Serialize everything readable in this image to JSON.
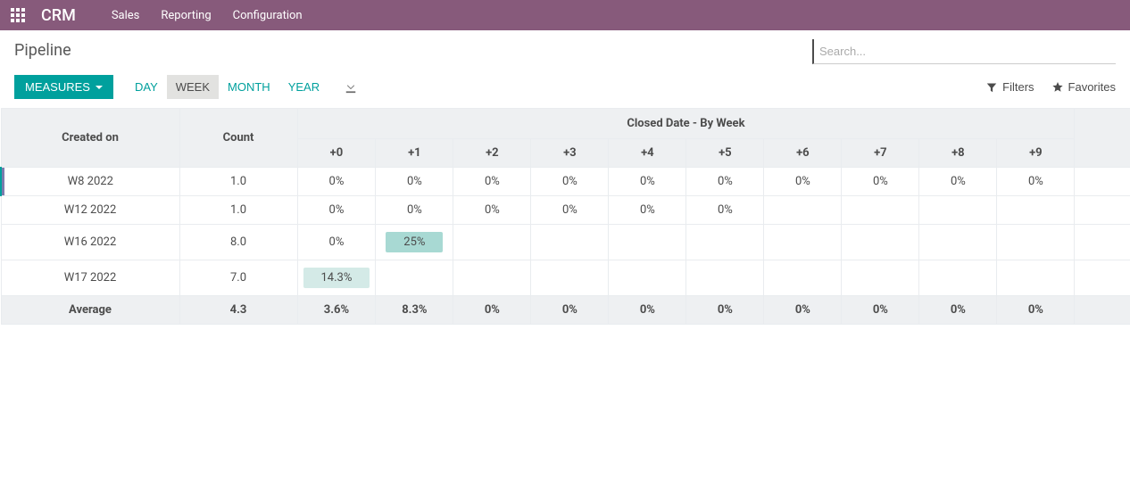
{
  "navbar": {
    "brand": "CRM",
    "links": [
      "Sales",
      "Reporting",
      "Configuration"
    ]
  },
  "page": {
    "title": "Pipeline"
  },
  "search": {
    "placeholder": "Search..."
  },
  "toolbar": {
    "measures_label": "MEASURES",
    "ranges": [
      {
        "label": "DAY",
        "active": false
      },
      {
        "label": "WEEK",
        "active": true
      },
      {
        "label": "MONTH",
        "active": false
      },
      {
        "label": "YEAR",
        "active": false
      }
    ],
    "filters_label": "Filters",
    "favorites_label": "Favorites"
  },
  "table": {
    "col_created_on": "Created on",
    "col_count": "Count",
    "super_header": "Closed Date - By Week",
    "period_headers": [
      "+0",
      "+1",
      "+2",
      "+3",
      "+4",
      "+5",
      "+6",
      "+7",
      "+8",
      "+9"
    ],
    "rows": [
      {
        "label": "W8 2022",
        "count": "1.0",
        "highlight": true,
        "cells": [
          {
            "v": "0%"
          },
          {
            "v": "0%"
          },
          {
            "v": "0%"
          },
          {
            "v": "0%"
          },
          {
            "v": "0%"
          },
          {
            "v": "0%"
          },
          {
            "v": "0%"
          },
          {
            "v": "0%"
          },
          {
            "v": "0%"
          },
          {
            "v": "0%"
          }
        ]
      },
      {
        "label": "W12 2022",
        "count": "1.0",
        "highlight": false,
        "cells": [
          {
            "v": "0%"
          },
          {
            "v": "0%"
          },
          {
            "v": "0%"
          },
          {
            "v": "0%"
          },
          {
            "v": "0%"
          },
          {
            "v": "0%"
          },
          {
            "v": ""
          },
          {
            "v": ""
          },
          {
            "v": ""
          },
          {
            "v": ""
          }
        ]
      },
      {
        "label": "W16 2022",
        "count": "8.0",
        "highlight": false,
        "cells": [
          {
            "v": "0%"
          },
          {
            "v": "25%",
            "shade": 2
          },
          {
            "v": ""
          },
          {
            "v": ""
          },
          {
            "v": ""
          },
          {
            "v": ""
          },
          {
            "v": ""
          },
          {
            "v": ""
          },
          {
            "v": ""
          },
          {
            "v": ""
          }
        ]
      },
      {
        "label": "W17 2022",
        "count": "7.0",
        "highlight": false,
        "cells": [
          {
            "v": "14.3%",
            "shade": 1
          },
          {
            "v": ""
          },
          {
            "v": ""
          },
          {
            "v": ""
          },
          {
            "v": ""
          },
          {
            "v": ""
          },
          {
            "v": ""
          },
          {
            "v": ""
          },
          {
            "v": ""
          },
          {
            "v": ""
          }
        ]
      }
    ],
    "average": {
      "label": "Average",
      "count": "4.3",
      "cells": [
        "3.6%",
        "8.3%",
        "0%",
        "0%",
        "0%",
        "0%",
        "0%",
        "0%",
        "0%",
        "0%"
      ]
    }
  }
}
